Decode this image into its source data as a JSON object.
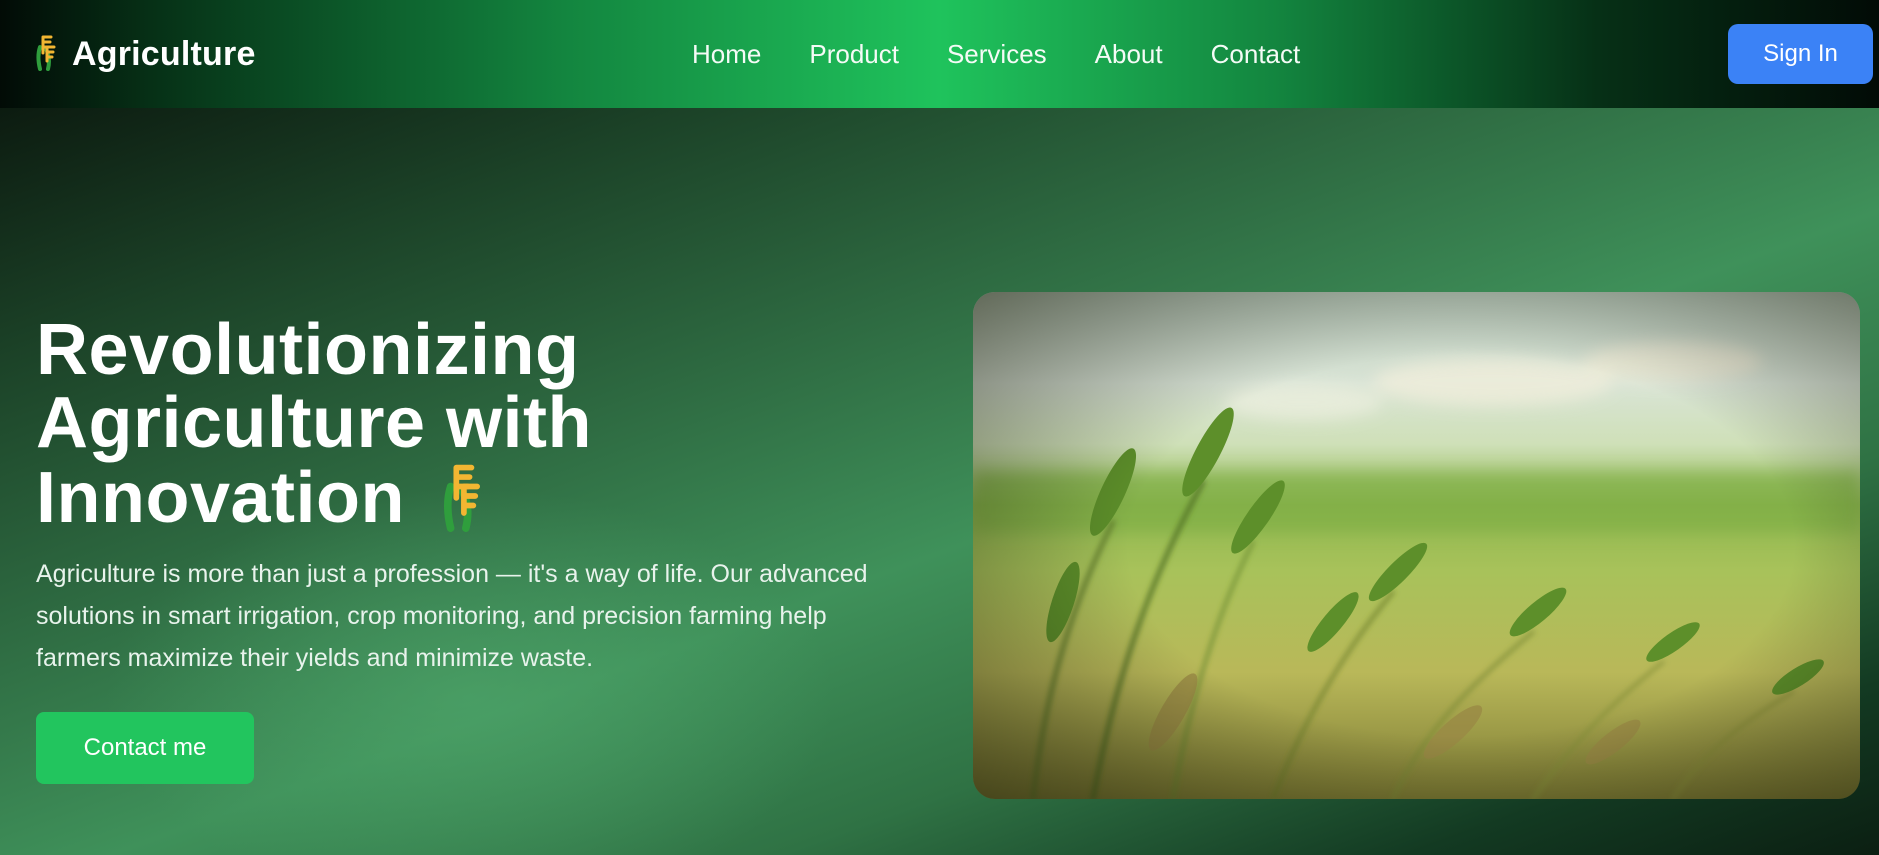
{
  "brand": {
    "name": "Agriculture",
    "logo_icon": "wheat-icon"
  },
  "nav": {
    "links": [
      "Home",
      "Product",
      "Services",
      "About",
      "Contact"
    ],
    "signin_label": "Sign In"
  },
  "hero": {
    "title_lines": [
      "Revolutionizing",
      "Agriculture with",
      "Innovation"
    ],
    "title_icon": "wheat-icon",
    "description": "Agriculture is more than just a profession — it's a way of life. Our advanced solutions in smart irrigation, crop monitoring, and precision farming help farmers maximize their yields and minimize waste.",
    "cta_label": "Contact me",
    "image": "wheat-field-photo"
  },
  "colors": {
    "nav_accent": "#1fc35c",
    "signin_button": "#3b82f6",
    "cta_button": "#22c55e",
    "hero_green": "#3f915a"
  }
}
